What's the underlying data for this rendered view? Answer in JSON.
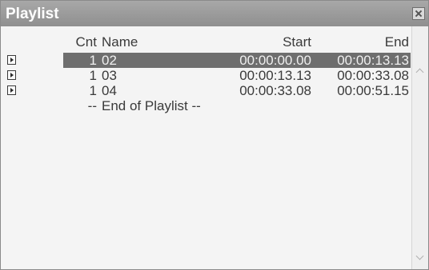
{
  "window": {
    "title": "Playlist"
  },
  "columns": {
    "cnt": "Cnt",
    "name": "Name",
    "start": "Start",
    "end": "End"
  },
  "rows": [
    {
      "cnt": "1",
      "name": "02",
      "start": "00:00:00.00",
      "end": "00:00:13.13",
      "selected": true,
      "icon": "play-icon"
    },
    {
      "cnt": "1",
      "name": "03",
      "start": "00:00:13.13",
      "end": "00:00:33.08",
      "selected": false,
      "icon": "play-icon"
    },
    {
      "cnt": "1",
      "name": "04",
      "start": "00:00:33.08",
      "end": "00:00:51.15",
      "selected": false,
      "icon": "play-icon"
    }
  ],
  "end_marker": {
    "cnt": "--",
    "name": "End of Playlist --"
  },
  "colors": {
    "titlebar": "#989898",
    "selection": "#6e6e6e",
    "background": "#f4f4f4"
  }
}
